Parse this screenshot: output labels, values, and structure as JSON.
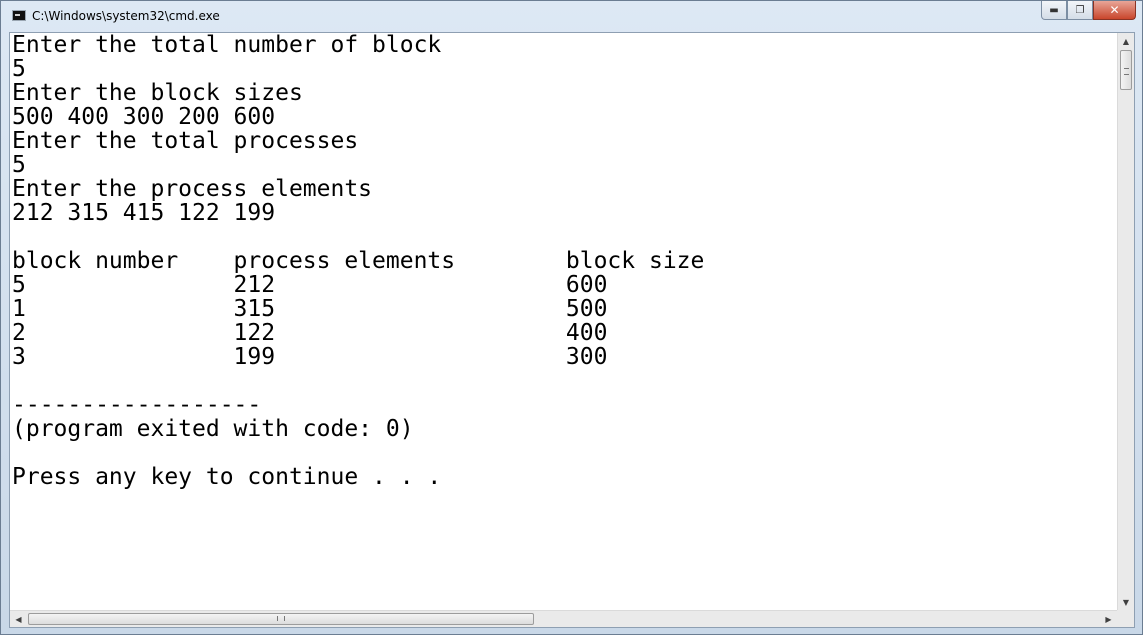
{
  "window": {
    "title": "C:\\Windows\\system32\\cmd.exe",
    "controls": {
      "minimize": "▬",
      "maximize": "❐",
      "close": "✕"
    }
  },
  "console": {
    "lines": [
      "Enter the total number of block",
      "5",
      "Enter the block sizes",
      "500 400 300 200 600",
      "Enter the total processes",
      "5",
      "Enter the process elements",
      "212 315 415 122 199",
      "",
      "block number    process elements        block size",
      "5               212                     600",
      "1               315                     500",
      "2               122                     400",
      "3               199                     300",
      "",
      "------------------",
      "(program exited with code: 0)",
      "",
      "Press any key to continue . . ."
    ]
  },
  "scrollbars": {
    "up_arrow": "▲",
    "down_arrow": "▼",
    "left_arrow": "◀",
    "right_arrow": "▶"
  }
}
